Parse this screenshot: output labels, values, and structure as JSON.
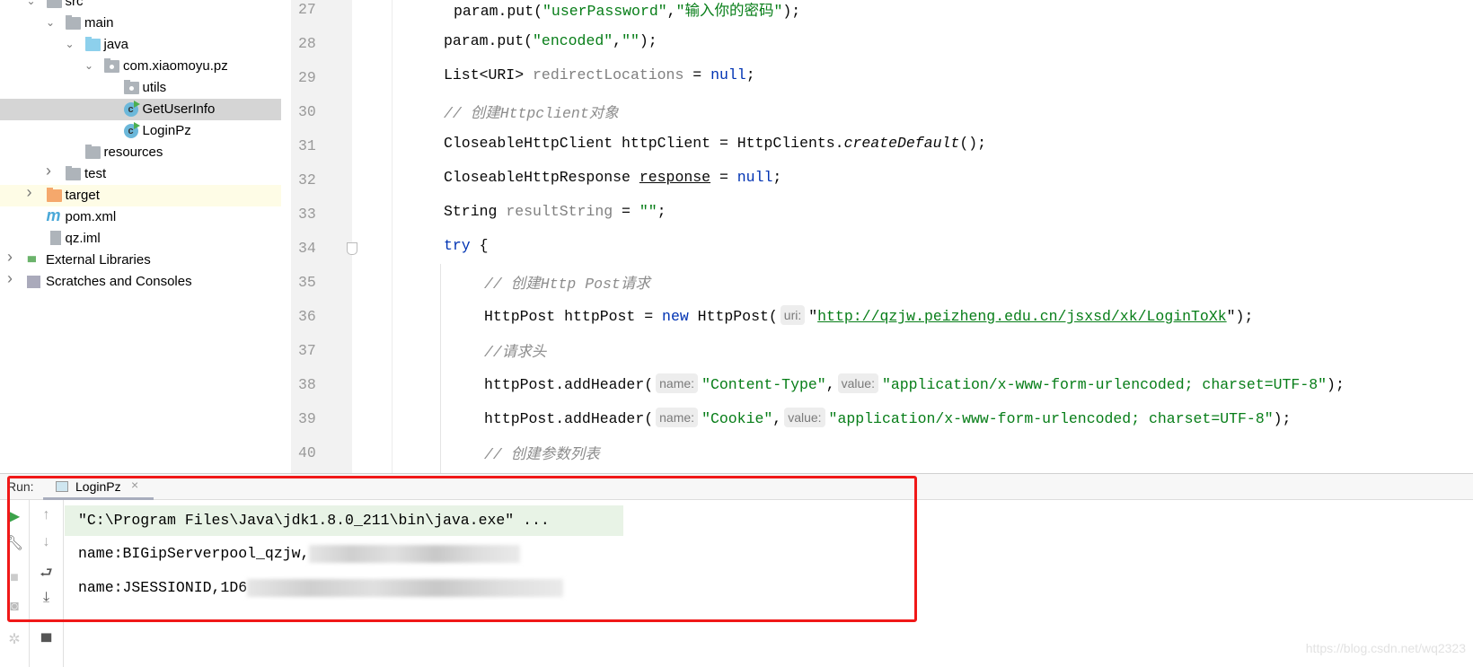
{
  "project_tree": [
    {
      "label": "src",
      "level": 1,
      "icon": "folder-icon",
      "expanded": true
    },
    {
      "label": "main",
      "level": 2,
      "icon": "folder-icon",
      "expanded": true
    },
    {
      "label": "java",
      "level": 3,
      "icon": "source-folder-icon",
      "expanded": true
    },
    {
      "label": "com.xiaomoyu.pz",
      "level": 4,
      "icon": "package-icon",
      "expanded": true
    },
    {
      "label": "utils",
      "level": 5,
      "icon": "package-icon"
    },
    {
      "label": "GetUserInfo",
      "level": 5,
      "icon": "java-class-icon",
      "selected": true
    },
    {
      "label": "LoginPz",
      "level": 5,
      "icon": "java-class-icon"
    },
    {
      "label": "resources",
      "level": 3,
      "icon": "resources-folder-icon"
    },
    {
      "label": "test",
      "level": 2,
      "icon": "folder-icon",
      "expanded": false
    },
    {
      "label": "target",
      "level": 1,
      "icon": "excluded-folder-icon",
      "expanded": false,
      "highlighted": true
    },
    {
      "label": "pom.xml",
      "level": 1,
      "icon": "maven-icon"
    },
    {
      "label": "qz.iml",
      "level": 1,
      "icon": "iml-file-icon"
    },
    {
      "label": "External Libraries",
      "level": 0,
      "icon": "libraries-icon",
      "expanded": false
    },
    {
      "label": "Scratches and Consoles",
      "level": 0,
      "icon": "scratches-icon",
      "expanded": false
    }
  ],
  "editor": {
    "lines": [
      {
        "n": "27",
        "indent": 0,
        "extra": " ",
        "tokens": [
          [
            "param.put(",
            ""
          ],
          [
            "\"userPassword\"",
            "s"
          ],
          [
            ",",
            ""
          ],
          [
            "\"输入你的密码\"",
            "s"
          ],
          [
            ");",
            ""
          ]
        ]
      },
      {
        "n": "28",
        "indent": 0,
        "tokens": [
          [
            "param.put(",
            ""
          ],
          [
            "\"encoded\"",
            "s"
          ],
          [
            ",",
            ""
          ],
          [
            "\"\"",
            "s"
          ],
          [
            ");",
            ""
          ]
        ]
      },
      {
        "n": "29",
        "indent": 0,
        "tokens": [
          [
            "List<URI> ",
            ""
          ],
          [
            "redirectLocations",
            "g"
          ],
          [
            " = ",
            ""
          ],
          [
            "null",
            "k"
          ],
          [
            ";",
            ""
          ]
        ]
      },
      {
        "n": "30",
        "indent": 0,
        "tokens": [
          [
            "// 创建Httpclient对象",
            "c"
          ]
        ]
      },
      {
        "n": "31",
        "indent": 0,
        "tokens": [
          [
            "CloseableHttpClient httpClient = HttpClients.",
            ""
          ],
          [
            "createDefault",
            "i"
          ],
          [
            "();",
            ""
          ]
        ]
      },
      {
        "n": "32",
        "indent": 0,
        "tokens": [
          [
            "CloseableHttpResponse ",
            ""
          ],
          [
            "response",
            "u"
          ],
          [
            " = ",
            ""
          ],
          [
            "null",
            "k"
          ],
          [
            ";",
            ""
          ]
        ]
      },
      {
        "n": "33",
        "indent": 0,
        "tokens": [
          [
            "String ",
            ""
          ],
          [
            "resultString",
            "g"
          ],
          [
            " = ",
            ""
          ],
          [
            "\"\"",
            "s"
          ],
          [
            ";",
            ""
          ]
        ]
      },
      {
        "n": "34",
        "indent": 0,
        "tokens": [
          [
            "try",
            "k"
          ],
          [
            " {",
            ""
          ]
        ]
      },
      {
        "n": "35",
        "indent": 1,
        "tokens": [
          [
            "// 创建Http Post请求",
            "c"
          ]
        ]
      },
      {
        "n": "36",
        "indent": 1,
        "tokens": [
          [
            "HttpPost httpPost = ",
            ""
          ],
          [
            "new",
            "k"
          ],
          [
            " HttpPost(",
            ""
          ],
          [
            "uri:",
            "hint"
          ],
          [
            "\"",
            ""
          ],
          [
            "http://qzjw.peizheng.edu.cn/jsxsd/xk/LoginToXk",
            "su"
          ],
          [
            "\");",
            ""
          ]
        ]
      },
      {
        "n": "37",
        "indent": 1,
        "tokens": [
          [
            "//请求头",
            "c"
          ]
        ]
      },
      {
        "n": "38",
        "indent": 1,
        "tokens": [
          [
            "httpPost.addHeader(",
            ""
          ],
          [
            "name:",
            "hint"
          ],
          [
            "\"Content-Type\"",
            "s"
          ],
          [
            ",",
            ""
          ],
          [
            "value:",
            "hint"
          ],
          [
            "\"application/x-www-form-urlencoded; charset=UTF-8\"",
            "s"
          ],
          [
            ");",
            ""
          ]
        ]
      },
      {
        "n": "39",
        "indent": 1,
        "tokens": [
          [
            "httpPost.addHeader(",
            ""
          ],
          [
            "name:",
            "hint"
          ],
          [
            "\"Cookie\"",
            "s"
          ],
          [
            ",",
            ""
          ],
          [
            "value:",
            "hint"
          ],
          [
            "\"application/x-www-form-urlencoded; charset=UTF-8\"",
            "s"
          ],
          [
            ");",
            ""
          ]
        ]
      },
      {
        "n": "40",
        "indent": 1,
        "tokens": [
          [
            "// 创建参数列表",
            "c"
          ]
        ]
      }
    ]
  },
  "run": {
    "label": "Run:",
    "tab": "LoginPz",
    "output": [
      "\"C:\\Program Files\\Java\\jdk1.8.0_211\\bin\\java.exe\" ...",
      "name:BIGipServerpool_qzjw,",
      "name:JSESSIONID,1D6"
    ]
  },
  "watermark": "https://blog.csdn.net/wq2323",
  "colors": {
    "keyword": "#0033b3",
    "string": "#067d17",
    "comment": "#8c8c8c",
    "highlight_box": "#f01818",
    "selection": "#d5d5d5"
  }
}
